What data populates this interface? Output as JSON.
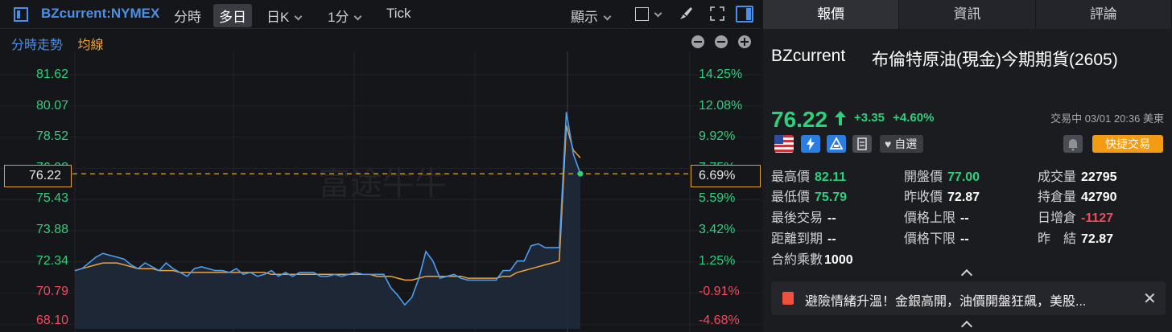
{
  "toolbar": {
    "symbol": "BZcurrent:NYMEX",
    "items": [
      "分時",
      "多日",
      "日K",
      "1分",
      "Tick"
    ],
    "active": "多日",
    "display_label": "顯示"
  },
  "subheader": {
    "intraday": "分時走勢",
    "average": "均線"
  },
  "chart": {
    "y_left_labels": [
      "81.62",
      "80.07",
      "78.52",
      "76.98",
      "75.43",
      "73.88",
      "72.34",
      "70.79",
      "68.10"
    ],
    "y_right_labels": [
      "14.25%",
      "12.08%",
      "9.92%",
      "7.75%",
      "5.59%",
      "3.42%",
      "1.25%",
      "-0.91%",
      "-4.68%"
    ],
    "current_price": "76.22",
    "current_pct": "6.69%",
    "watermark": "富途牛牛"
  },
  "chart_data": {
    "type": "line",
    "ylim": [
      68.1,
      82.5
    ],
    "series": [
      {
        "values": [
          71.15,
          71.25,
          71.55,
          71.85,
          72.05,
          71.95,
          71.85,
          71.75,
          71.45,
          71.25,
          71.55,
          71.35,
          71.15,
          71.55,
          71.25,
          71.05,
          70.85,
          71.25,
          71.35,
          71.25,
          71.15,
          71.15,
          71.05,
          71.25,
          70.95,
          71.05,
          70.85,
          70.95,
          71.15,
          70.85,
          71.05,
          70.85,
          71.05,
          71.05,
          71.05,
          70.85,
          70.85,
          70.95,
          70.85,
          70.95,
          71.05,
          70.95,
          70.95,
          70.95,
          70.95,
          70.25,
          69.85,
          69.35,
          69.75,
          70.75,
          72.15,
          71.65,
          70.75,
          70.85,
          70.95,
          70.75,
          70.65,
          70.65,
          70.65,
          70.65,
          70.65,
          71.15,
          71.15,
          71.65,
          71.65,
          72.45,
          72.55,
          72.35,
          72.35,
          72.35,
          79.45,
          77.25,
          76.22
        ]
      },
      {
        "values": [
          71.15,
          71.25,
          71.35,
          71.45,
          71.55,
          71.55,
          71.55,
          71.45,
          71.35,
          71.25,
          71.25,
          71.25,
          71.15,
          71.15,
          71.15,
          71.05,
          71.05,
          71.05,
          71.05,
          71.05,
          71.05,
          71.05,
          71.05,
          71.05,
          71.05,
          71.05,
          71.05,
          71.05,
          70.95,
          70.95,
          70.95,
          70.95,
          70.95,
          70.95,
          70.95,
          70.95,
          70.95,
          70.95,
          70.95,
          70.95,
          70.95,
          70.95,
          70.95,
          70.85,
          70.85,
          70.85,
          70.75,
          70.65,
          70.65,
          70.75,
          70.85,
          70.85,
          70.85,
          70.85,
          70.85,
          70.85,
          70.75,
          70.75,
          70.75,
          70.75,
          70.75,
          70.85,
          70.85,
          71.05,
          71.15,
          71.25,
          71.35,
          71.45,
          71.55,
          71.65,
          78.75,
          77.45,
          77.05
        ]
      }
    ]
  },
  "tabs": [
    "報價",
    "資訊",
    "評論"
  ],
  "quote": {
    "code": "BZcurrent",
    "name": "布倫特原油(現金)今期期貨(2605)",
    "last": "76.22",
    "change": "+3.35",
    "change_pct": "+4.60%",
    "status": "交易中 03/01 20:36 美東",
    "watchlist": "自選",
    "quick_trade": "快捷交易"
  },
  "stats": {
    "high_label": "最高價",
    "high": "82.11",
    "open_label": "開盤價",
    "open": "77.00",
    "volume_label": "成交量",
    "volume": "22795",
    "low_label": "最低價",
    "low": "75.79",
    "prev_close_label": "昨收價",
    "prev_close": "72.87",
    "oi_label": "持倉量",
    "oi": "42790",
    "last_trade_label": "最後交易",
    "last_trade": "--",
    "upper_limit_label": "價格上限",
    "upper_limit": "--",
    "oi_change_label": "日增倉",
    "oi_change": "-1127",
    "expiry_label": "距離到期",
    "expiry": "--",
    "lower_limit_label": "價格下限",
    "lower_limit": "--",
    "settle_label": "昨　結",
    "settle": "72.87",
    "multiplier_label": "合約乘數",
    "multiplier": "1000"
  },
  "news": {
    "headline": "避險情緒升溫！金銀高開，油價開盤狂飆，美股..."
  },
  "colors": {
    "up": "#2fd07c",
    "down": "#f2495c",
    "accent": "#4a8fe8",
    "avg": "#f0a236",
    "quick": "#f39b12"
  }
}
